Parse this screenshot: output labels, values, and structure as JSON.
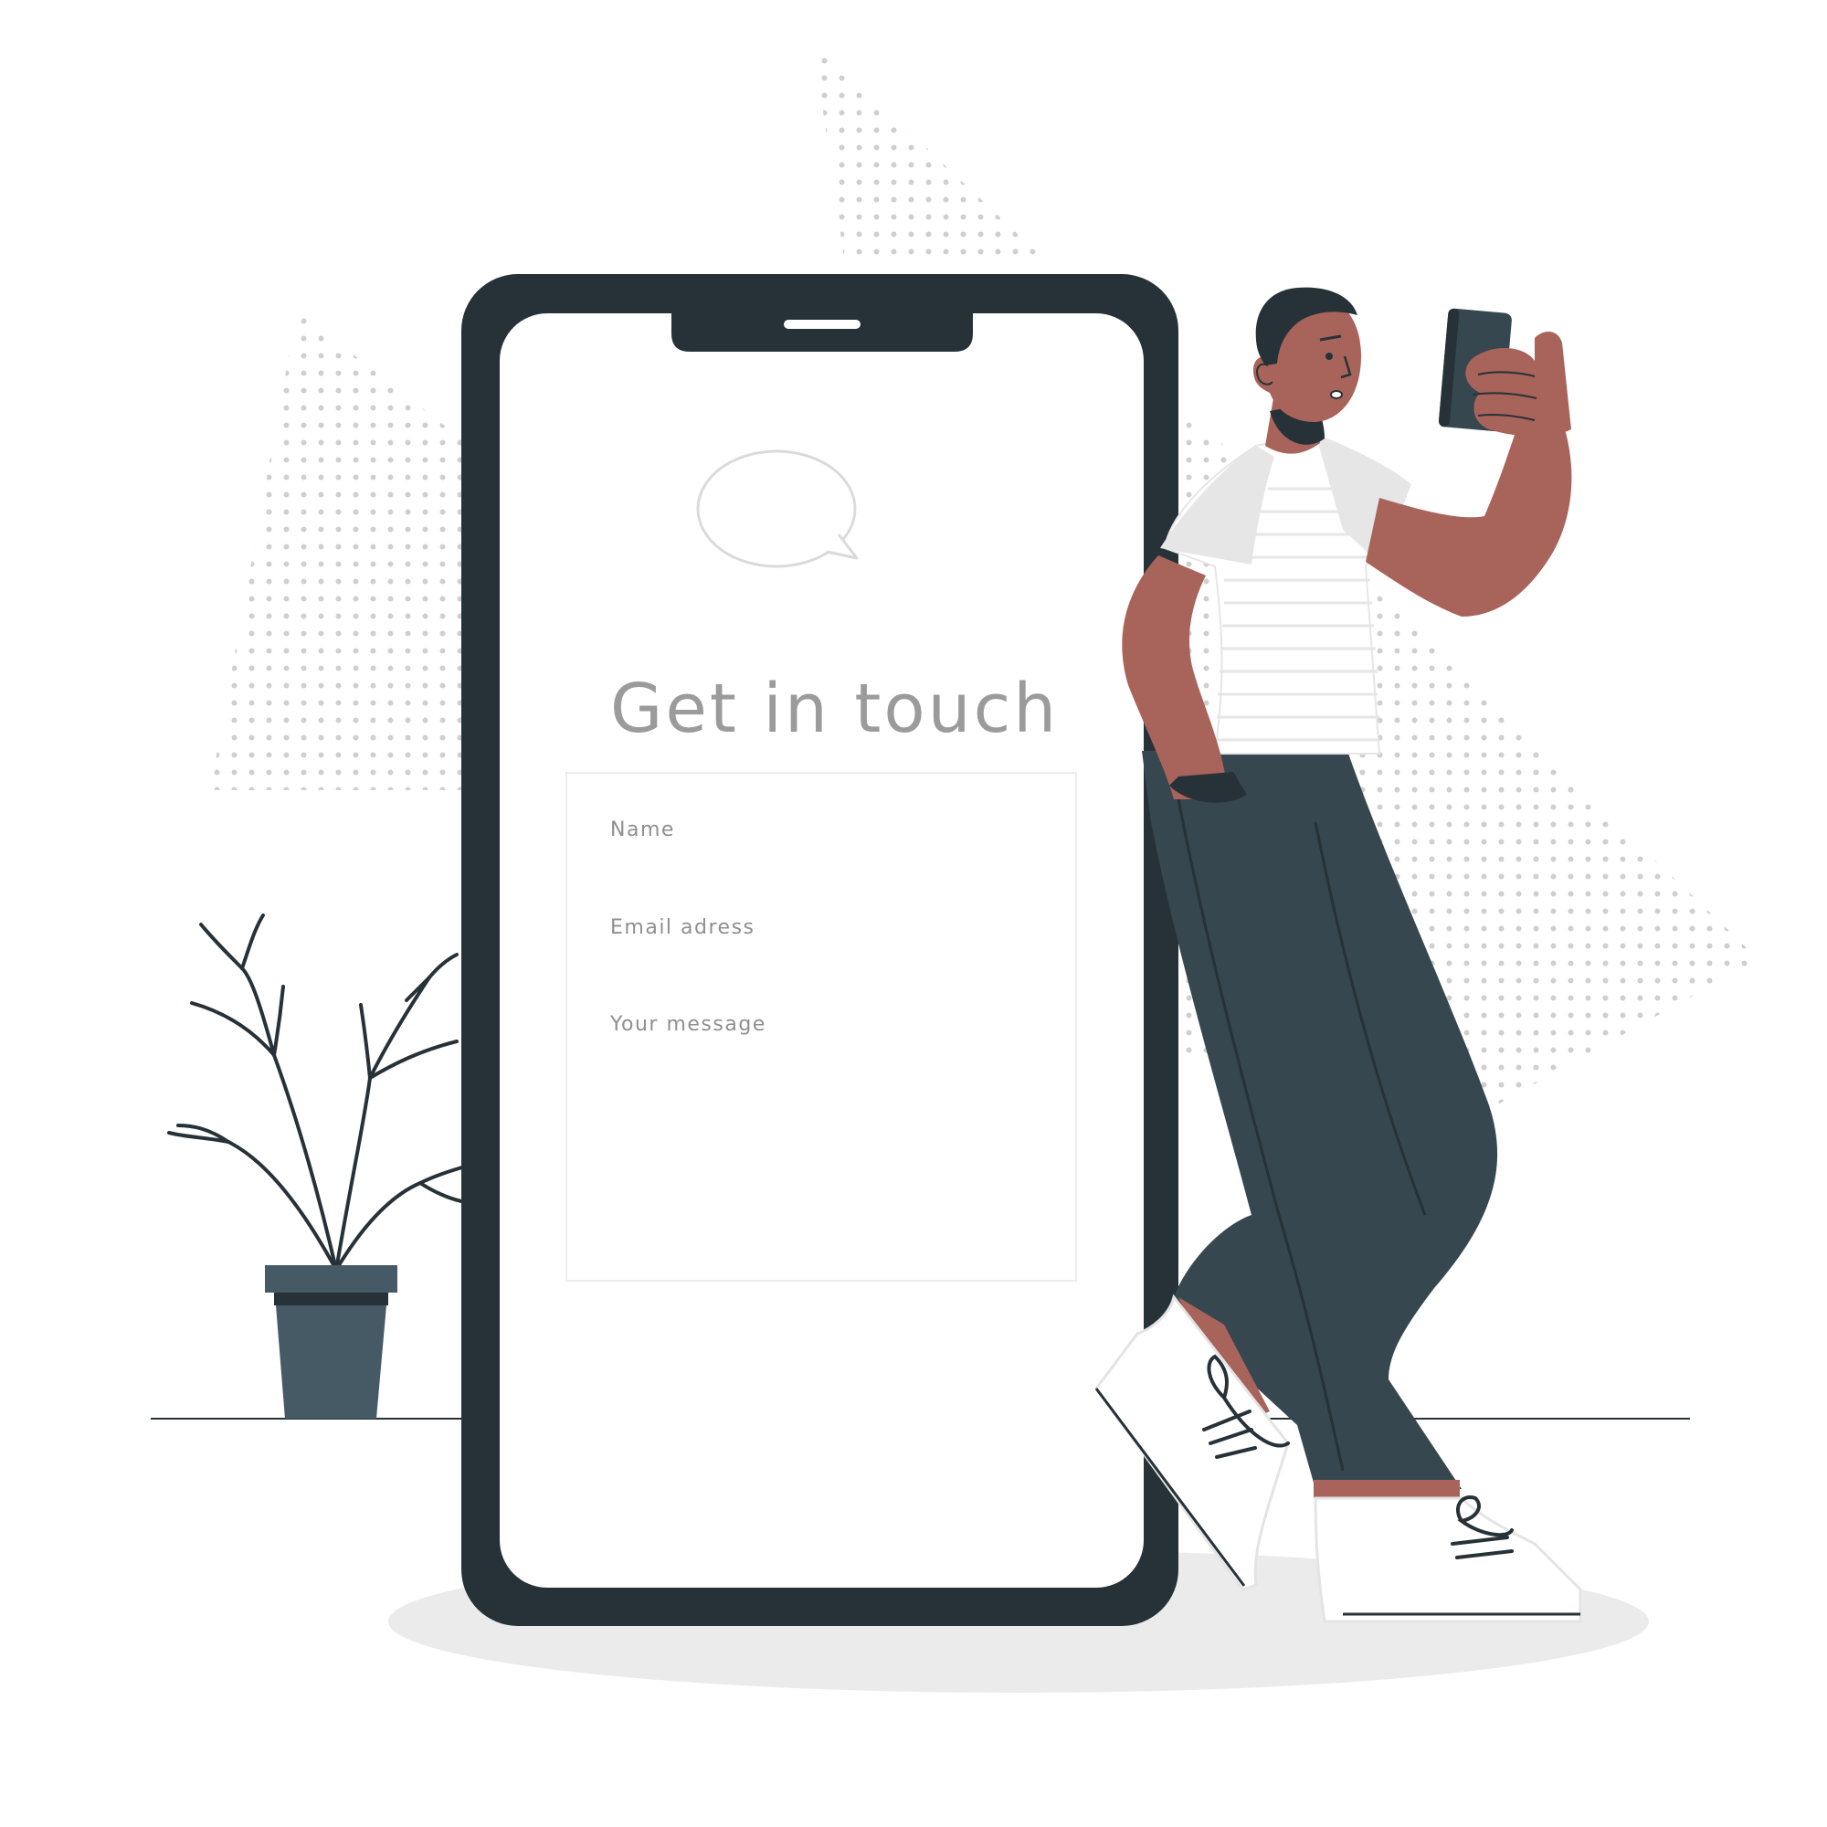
{
  "screen": {
    "title": "Get in touch",
    "fields": [
      {
        "label": "Name"
      },
      {
        "label": "Email adress"
      },
      {
        "label": "Your message"
      }
    ]
  },
  "icons": {
    "speech_bubble": "speech-bubble-icon",
    "phone_speaker": "speaker-icon"
  },
  "colors": {
    "phone_frame": "#263238",
    "skin": "#a8635a",
    "pants": "#37474f",
    "shirt": "#e6e6e6",
    "pot": "#455a64",
    "dots": "#cfcfcf",
    "text": "#9b9b9b"
  }
}
